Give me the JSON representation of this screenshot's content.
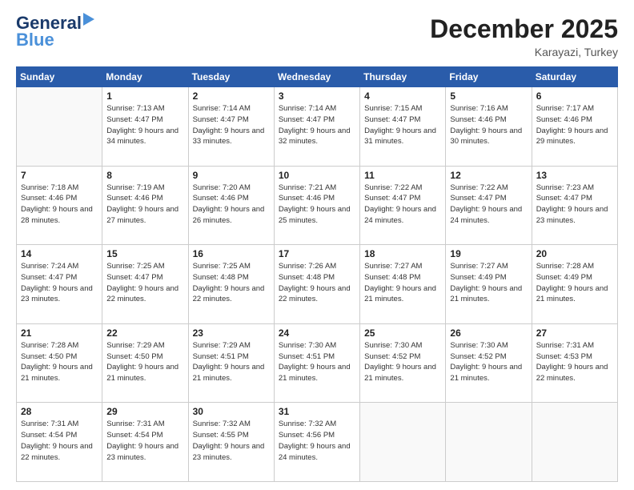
{
  "header": {
    "logo_line1": "General",
    "logo_line2": "Blue",
    "month": "December 2025",
    "location": "Karayazi, Turkey"
  },
  "weekdays": [
    "Sunday",
    "Monday",
    "Tuesday",
    "Wednesday",
    "Thursday",
    "Friday",
    "Saturday"
  ],
  "weeks": [
    [
      {
        "day": "",
        "sunrise": "",
        "sunset": "",
        "daylight": ""
      },
      {
        "day": "1",
        "sunrise": "Sunrise: 7:13 AM",
        "sunset": "Sunset: 4:47 PM",
        "daylight": "Daylight: 9 hours and 34 minutes."
      },
      {
        "day": "2",
        "sunrise": "Sunrise: 7:14 AM",
        "sunset": "Sunset: 4:47 PM",
        "daylight": "Daylight: 9 hours and 33 minutes."
      },
      {
        "day": "3",
        "sunrise": "Sunrise: 7:14 AM",
        "sunset": "Sunset: 4:47 PM",
        "daylight": "Daylight: 9 hours and 32 minutes."
      },
      {
        "day": "4",
        "sunrise": "Sunrise: 7:15 AM",
        "sunset": "Sunset: 4:47 PM",
        "daylight": "Daylight: 9 hours and 31 minutes."
      },
      {
        "day": "5",
        "sunrise": "Sunrise: 7:16 AM",
        "sunset": "Sunset: 4:46 PM",
        "daylight": "Daylight: 9 hours and 30 minutes."
      },
      {
        "day": "6",
        "sunrise": "Sunrise: 7:17 AM",
        "sunset": "Sunset: 4:46 PM",
        "daylight": "Daylight: 9 hours and 29 minutes."
      }
    ],
    [
      {
        "day": "7",
        "sunrise": "Sunrise: 7:18 AM",
        "sunset": "Sunset: 4:46 PM",
        "daylight": "Daylight: 9 hours and 28 minutes."
      },
      {
        "day": "8",
        "sunrise": "Sunrise: 7:19 AM",
        "sunset": "Sunset: 4:46 PM",
        "daylight": "Daylight: 9 hours and 27 minutes."
      },
      {
        "day": "9",
        "sunrise": "Sunrise: 7:20 AM",
        "sunset": "Sunset: 4:46 PM",
        "daylight": "Daylight: 9 hours and 26 minutes."
      },
      {
        "day": "10",
        "sunrise": "Sunrise: 7:21 AM",
        "sunset": "Sunset: 4:46 PM",
        "daylight": "Daylight: 9 hours and 25 minutes."
      },
      {
        "day": "11",
        "sunrise": "Sunrise: 7:22 AM",
        "sunset": "Sunset: 4:47 PM",
        "daylight": "Daylight: 9 hours and 24 minutes."
      },
      {
        "day": "12",
        "sunrise": "Sunrise: 7:22 AM",
        "sunset": "Sunset: 4:47 PM",
        "daylight": "Daylight: 9 hours and 24 minutes."
      },
      {
        "day": "13",
        "sunrise": "Sunrise: 7:23 AM",
        "sunset": "Sunset: 4:47 PM",
        "daylight": "Daylight: 9 hours and 23 minutes."
      }
    ],
    [
      {
        "day": "14",
        "sunrise": "Sunrise: 7:24 AM",
        "sunset": "Sunset: 4:47 PM",
        "daylight": "Daylight: 9 hours and 23 minutes."
      },
      {
        "day": "15",
        "sunrise": "Sunrise: 7:25 AM",
        "sunset": "Sunset: 4:47 PM",
        "daylight": "Daylight: 9 hours and 22 minutes."
      },
      {
        "day": "16",
        "sunrise": "Sunrise: 7:25 AM",
        "sunset": "Sunset: 4:48 PM",
        "daylight": "Daylight: 9 hours and 22 minutes."
      },
      {
        "day": "17",
        "sunrise": "Sunrise: 7:26 AM",
        "sunset": "Sunset: 4:48 PM",
        "daylight": "Daylight: 9 hours and 22 minutes."
      },
      {
        "day": "18",
        "sunrise": "Sunrise: 7:27 AM",
        "sunset": "Sunset: 4:48 PM",
        "daylight": "Daylight: 9 hours and 21 minutes."
      },
      {
        "day": "19",
        "sunrise": "Sunrise: 7:27 AM",
        "sunset": "Sunset: 4:49 PM",
        "daylight": "Daylight: 9 hours and 21 minutes."
      },
      {
        "day": "20",
        "sunrise": "Sunrise: 7:28 AM",
        "sunset": "Sunset: 4:49 PM",
        "daylight": "Daylight: 9 hours and 21 minutes."
      }
    ],
    [
      {
        "day": "21",
        "sunrise": "Sunrise: 7:28 AM",
        "sunset": "Sunset: 4:50 PM",
        "daylight": "Daylight: 9 hours and 21 minutes."
      },
      {
        "day": "22",
        "sunrise": "Sunrise: 7:29 AM",
        "sunset": "Sunset: 4:50 PM",
        "daylight": "Daylight: 9 hours and 21 minutes."
      },
      {
        "day": "23",
        "sunrise": "Sunrise: 7:29 AM",
        "sunset": "Sunset: 4:51 PM",
        "daylight": "Daylight: 9 hours and 21 minutes."
      },
      {
        "day": "24",
        "sunrise": "Sunrise: 7:30 AM",
        "sunset": "Sunset: 4:51 PM",
        "daylight": "Daylight: 9 hours and 21 minutes."
      },
      {
        "day": "25",
        "sunrise": "Sunrise: 7:30 AM",
        "sunset": "Sunset: 4:52 PM",
        "daylight": "Daylight: 9 hours and 21 minutes."
      },
      {
        "day": "26",
        "sunrise": "Sunrise: 7:30 AM",
        "sunset": "Sunset: 4:52 PM",
        "daylight": "Daylight: 9 hours and 21 minutes."
      },
      {
        "day": "27",
        "sunrise": "Sunrise: 7:31 AM",
        "sunset": "Sunset: 4:53 PM",
        "daylight": "Daylight: 9 hours and 22 minutes."
      }
    ],
    [
      {
        "day": "28",
        "sunrise": "Sunrise: 7:31 AM",
        "sunset": "Sunset: 4:54 PM",
        "daylight": "Daylight: 9 hours and 22 minutes."
      },
      {
        "day": "29",
        "sunrise": "Sunrise: 7:31 AM",
        "sunset": "Sunset: 4:54 PM",
        "daylight": "Daylight: 9 hours and 23 minutes."
      },
      {
        "day": "30",
        "sunrise": "Sunrise: 7:32 AM",
        "sunset": "Sunset: 4:55 PM",
        "daylight": "Daylight: 9 hours and 23 minutes."
      },
      {
        "day": "31",
        "sunrise": "Sunrise: 7:32 AM",
        "sunset": "Sunset: 4:56 PM",
        "daylight": "Daylight: 9 hours and 24 minutes."
      },
      {
        "day": "",
        "sunrise": "",
        "sunset": "",
        "daylight": ""
      },
      {
        "day": "",
        "sunrise": "",
        "sunset": "",
        "daylight": ""
      },
      {
        "day": "",
        "sunrise": "",
        "sunset": "",
        "daylight": ""
      }
    ]
  ]
}
